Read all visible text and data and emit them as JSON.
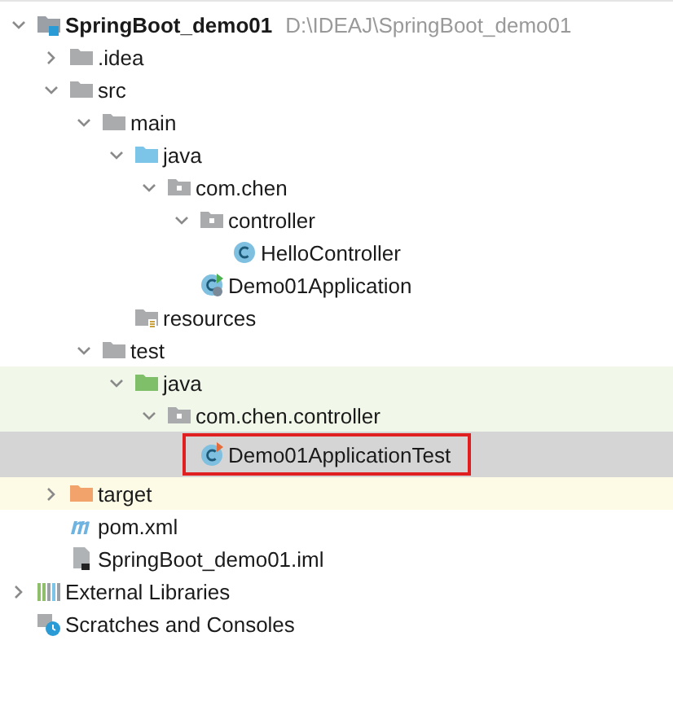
{
  "tree": [
    {
      "label": "SpringBoot_demo01",
      "path": "D:\\IDEAJ\\SpringBoot_demo01",
      "kind": "module",
      "expanded": true,
      "selected": false,
      "children": [
        {
          "label": ".idea",
          "kind": "folder",
          "expanded": false,
          "selected": false
        },
        {
          "label": "src",
          "kind": "folder",
          "expanded": true,
          "selected": false,
          "children": [
            {
              "label": "main",
              "kind": "folder",
              "expanded": true,
              "selected": false,
              "children": [
                {
                  "label": "java",
                  "kind": "source-folder",
                  "expanded": true,
                  "selected": false,
                  "children": [
                    {
                      "label": "com.chen",
                      "kind": "package",
                      "expanded": true,
                      "selected": false,
                      "children": [
                        {
                          "label": "controller",
                          "kind": "package",
                          "expanded": true,
                          "selected": false,
                          "children": [
                            {
                              "label": "HelloController",
                              "kind": "class",
                              "selected": false
                            }
                          ]
                        },
                        {
                          "label": "Demo01Application",
                          "kind": "boot-class",
                          "selected": false
                        }
                      ]
                    }
                  ]
                },
                {
                  "label": "resources",
                  "kind": "resources-folder",
                  "selected": false
                }
              ]
            },
            {
              "label": "test",
              "kind": "folder",
              "expanded": true,
              "selected": false,
              "children": [
                {
                  "label": "java",
                  "kind": "test-folder",
                  "expanded": true,
                  "selected": false,
                  "color": "#f1f8e9",
                  "children": [
                    {
                      "label": "com.chen.controller",
                      "kind": "package",
                      "expanded": true,
                      "selected": false,
                      "color": "#f1f8e9",
                      "children": [
                        {
                          "label": "Demo01ApplicationTest",
                          "kind": "test-class",
                          "selected": true,
                          "annotated": true
                        }
                      ]
                    }
                  ]
                }
              ]
            }
          ]
        },
        {
          "label": "target",
          "kind": "excluded-folder",
          "expanded": false,
          "selected": false,
          "color": "#fdfbe6"
        },
        {
          "label": "pom.xml",
          "kind": "maven",
          "selected": false
        },
        {
          "label": "SpringBoot_demo01.iml",
          "kind": "iml",
          "selected": false
        }
      ]
    },
    {
      "label": "External Libraries",
      "kind": "libraries",
      "expanded": false,
      "selected": false
    },
    {
      "label": "Scratches and Consoles",
      "kind": "scratches",
      "selected": false
    }
  ]
}
